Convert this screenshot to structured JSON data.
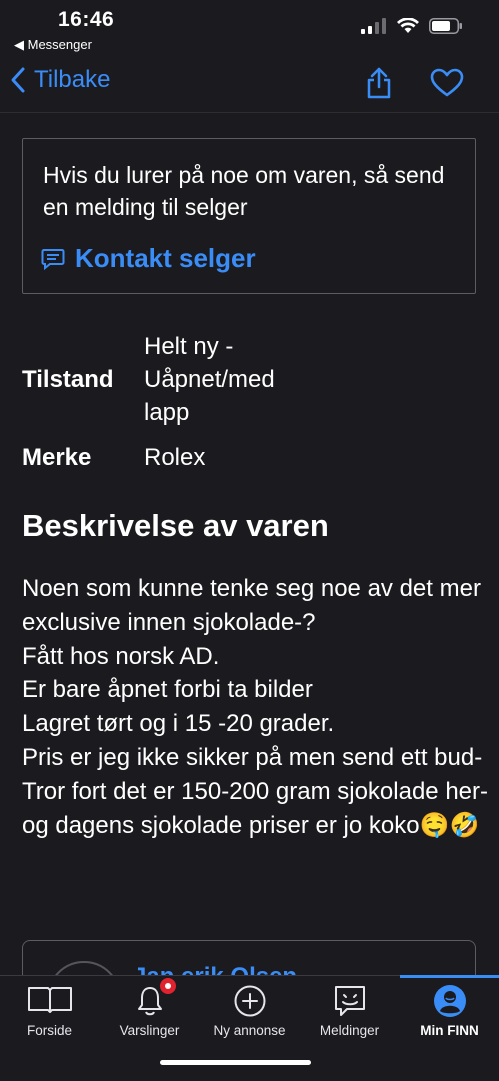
{
  "status": {
    "time": "16:46",
    "back_app": "◀ Messenger"
  },
  "nav": {
    "back_label": "Tilbake"
  },
  "contact": {
    "prompt": "Hvis du lurer på noe om varen, så send en melding til selger",
    "link_label": "Kontakt selger"
  },
  "specs": [
    {
      "label": "Tilstand",
      "value": "Helt ny - Uåpnet/med lapp"
    },
    {
      "label": "Merke",
      "value": "Rolex"
    }
  ],
  "description": {
    "title": "Beskrivelse av varen",
    "body": "Noen som kunne tenke seg noe av det mer exclusive innen sjokolade-?\nFått hos norsk AD.\nEr bare åpnet forbi ta bilder\nLagret tørt og i 15 -20 grader.\nPris er jeg ikke sikker på men send ett bud-\nTror fort det er 150-200 gram sjokolade her- og dagens sjokolade priser er jo koko🤤🤣"
  },
  "seller": {
    "name": "Jan erik Olsen"
  },
  "tabs": [
    {
      "label": "Forside",
      "icon": "map-book-icon"
    },
    {
      "label": "Varslinger",
      "icon": "bell-icon"
    },
    {
      "label": "Ny annonse",
      "icon": "plus-circle-icon"
    },
    {
      "label": "Meldinger",
      "icon": "chat-smile-icon"
    },
    {
      "label": "Min FINN",
      "icon": "profile-icon",
      "active": true
    }
  ],
  "colors": {
    "accent": "#3a8df7",
    "background": "#1b1b1f",
    "badge": "#e0232f"
  }
}
